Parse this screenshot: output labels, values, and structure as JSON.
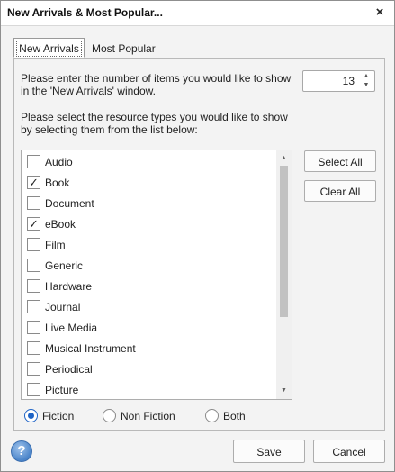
{
  "window": {
    "title": "New Arrivals & Most Popular...",
    "close_icon": "×"
  },
  "tabs": [
    {
      "label": "New Arrivals",
      "active": true
    },
    {
      "label": "Most Popular",
      "active": false
    }
  ],
  "count": {
    "prompt_line1": "Please enter the number of items you would like to show",
    "prompt_line2": "in the 'New Arrivals' window.",
    "value": "13",
    "up_icon": "▲",
    "down_icon": "▼"
  },
  "types": {
    "prompt_line1": "Please select the resource types you would like to show",
    "prompt_line2": "by selecting them from the list below:",
    "items": [
      {
        "label": "Audio",
        "checked": false
      },
      {
        "label": "Book",
        "checked": true
      },
      {
        "label": "Document",
        "checked": false
      },
      {
        "label": "eBook",
        "checked": true
      },
      {
        "label": "Film",
        "checked": false
      },
      {
        "label": "Generic",
        "checked": false
      },
      {
        "label": "Hardware",
        "checked": false
      },
      {
        "label": "Journal",
        "checked": false
      },
      {
        "label": "Live Media",
        "checked": false
      },
      {
        "label": "Musical Instrument",
        "checked": false
      },
      {
        "label": "Periodical",
        "checked": false
      },
      {
        "label": "Picture",
        "checked": false
      }
    ],
    "scroll_up_icon": "▲",
    "scroll_down_icon": "▼",
    "check_mark": "✓"
  },
  "buttons": {
    "select_all": "Select All",
    "clear_all": "Clear All",
    "save": "Save",
    "cancel": "Cancel"
  },
  "fiction_filter": {
    "options": [
      {
        "label": "Fiction",
        "selected": true
      },
      {
        "label": "Non Fiction",
        "selected": false
      },
      {
        "label": "Both",
        "selected": false
      }
    ]
  },
  "help": {
    "glyph": "?"
  },
  "colors": {
    "accent": "#1e63c6",
    "help_blue": "#4a84c9"
  }
}
